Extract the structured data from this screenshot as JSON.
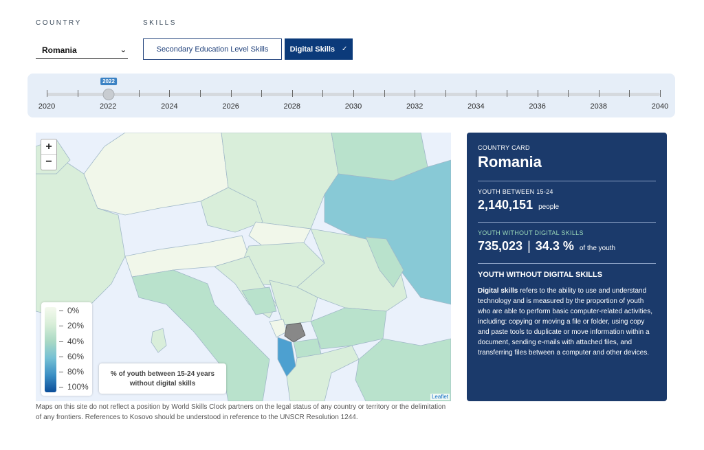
{
  "filters": {
    "country_label": "COUNTRY",
    "skills_label": "SKILLS",
    "country_value": "Romania",
    "skill_options": [
      "Secondary Education Level Skills",
      "Digital Skills"
    ],
    "selected_skill": "Digital Skills"
  },
  "timeline": {
    "years": [
      "2020",
      "2022",
      "2024",
      "2026",
      "2028",
      "2030",
      "2032",
      "2034",
      "2036",
      "2038",
      "2040"
    ],
    "selected_year": "2022"
  },
  "map": {
    "zoom_in": "+",
    "zoom_out": "−",
    "legend": [
      "0%",
      "20%",
      "40%",
      "60%",
      "80%",
      "100%"
    ],
    "caption": "% of youth between 15-24 years without digital skills",
    "attribution": "Leaflet",
    "colors": {
      "sea": "#eaf1fb",
      "low": "#f1f7ea",
      "mid_low": "#d9eeda",
      "mid": "#b9e2cc",
      "mid_high": "#88c9d6",
      "high": "#4da0d0",
      "missing": "#888888"
    }
  },
  "disclaimer": "Maps on this site do not reflect a position by World Skills Clock partners on the legal status of any country or territory or the delimitation of any frontiers. References to Kosovo should be understood in reference to the UNSCR Resolution 1244.",
  "card": {
    "header": "COUNTRY CARD",
    "country": "Romania",
    "youth_label": "YOUTH BETWEEN 15-24",
    "youth_value": "2,140,151",
    "youth_unit": "people",
    "without_label": "YOUTH WITHOUT DIGITAL SKILLS",
    "without_value": "735,023",
    "without_separator": "|",
    "without_pct": "34.3 %",
    "without_unit": "of the youth",
    "section_title": "YOUTH WITHOUT DIGITAL SKILLS",
    "desc_bold": "Digital skills",
    "desc_rest": " refers to the ability to use and understand technology and is measured by the proportion of youth who are able to perform basic computer-related activities, including: copying or moving a file or folder, using copy and paste tools to duplicate or move information within a document, sending e-mails with attached files, and transferring files between a computer and other devices."
  }
}
